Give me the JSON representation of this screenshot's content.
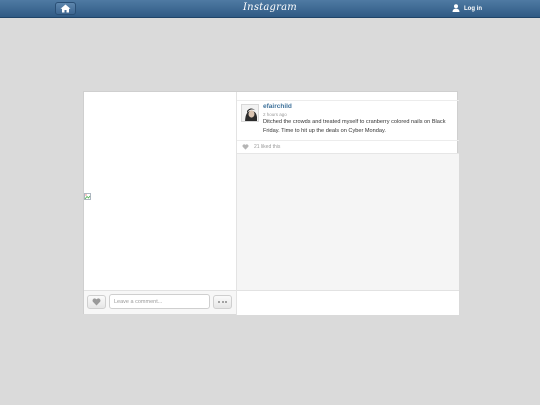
{
  "header": {
    "logo": "Instagram",
    "login_label": "Log in"
  },
  "post": {
    "username": "efairchild",
    "time": "2 hours ago",
    "caption": "Ditched the crowds and treated myself to cranberry colored nails on Black Friday. Time to hit up the deals on Cyber Monday.",
    "likes": "21 liked this"
  },
  "comment_box": {
    "placeholder": "Leave a comment..."
  },
  "colors": {
    "nav": "#3d6691",
    "username": "#3f729b",
    "background": "#dadada"
  },
  "icons": [
    "home-icon",
    "user-icon",
    "heart-icon",
    "more-dots-icon",
    "broken-image-icon",
    "small-heart-icon"
  ]
}
